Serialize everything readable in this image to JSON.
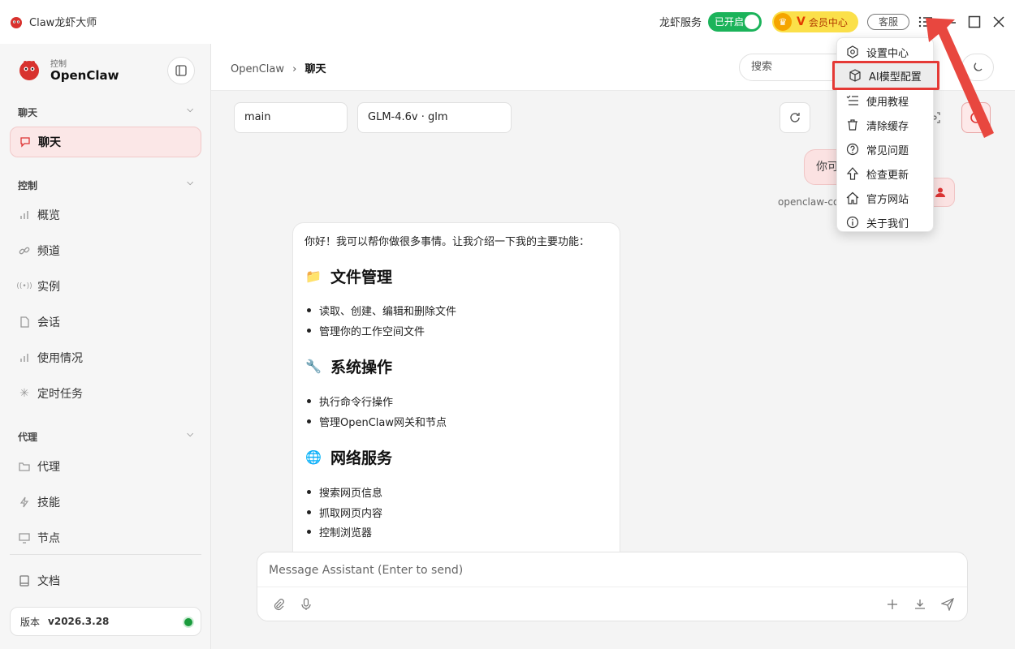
{
  "window": {
    "app_title": "Claw龙虾大师",
    "service_label": "龙虾服务",
    "service_toggle": "已开启",
    "vip_letter": "V",
    "vip_label": "会员中心",
    "support_button": "客服"
  },
  "sidebar": {
    "brand_sub": "控制",
    "brand_name": "OpenClaw",
    "sections": [
      {
        "title": "聊天",
        "items": [
          {
            "label": "聊天",
            "icon": "chat-icon",
            "active": true
          }
        ]
      },
      {
        "title": "控制",
        "items": [
          {
            "label": "概览",
            "icon": "bar-chart-icon"
          },
          {
            "label": "频道",
            "icon": "link-icon"
          },
          {
            "label": "实例",
            "icon": "broadcast-icon"
          },
          {
            "label": "会话",
            "icon": "document-icon"
          },
          {
            "label": "使用情况",
            "icon": "bar-chart-icon"
          },
          {
            "label": "定时任务",
            "icon": "loader-icon"
          }
        ]
      },
      {
        "title": "代理",
        "items": [
          {
            "label": "代理",
            "icon": "folder-icon"
          },
          {
            "label": "技能",
            "icon": "bolt-icon"
          },
          {
            "label": "节点",
            "icon": "monitor-icon"
          }
        ]
      }
    ],
    "docs_label": "文档",
    "version_label": "版本",
    "version_value": "v2026.3.28"
  },
  "header": {
    "breadcrumb_root": "OpenClaw",
    "breadcrumb_sep": "›",
    "breadcrumb_current": "聊天",
    "search_placeholder": "搜索"
  },
  "chat": {
    "session_select": "main",
    "model_select": "GLM-4.6v · glm",
    "user_message": "你可",
    "sender_name": "openclaw-con",
    "assistant": {
      "intro": "你好！我可以帮你做很多事情。让我介绍一下我的主要功能：",
      "sections": [
        {
          "emoji": "📁",
          "title": "文件管理",
          "items": [
            "读取、创建、编辑和删除文件",
            "管理你的工作空间文件"
          ]
        },
        {
          "emoji": "🔧",
          "title": "系统操作",
          "items": [
            "执行命令行操作",
            "管理OpenClaw网关和节点"
          ]
        },
        {
          "emoji": "🌐",
          "title": "网络服务",
          "items": [
            "搜索网页信息",
            "抓取网页内容",
            "控制浏览器"
          ]
        }
      ]
    },
    "composer_placeholder": "Message Assistant (Enter to send)"
  },
  "menu": {
    "items": [
      {
        "label": "设置中心",
        "icon": "settings-icon"
      },
      {
        "label": "AI模型配置",
        "icon": "cube-icon",
        "highlighted": true
      },
      {
        "label": "使用教程",
        "icon": "list-check-icon"
      },
      {
        "label": "清除缓存",
        "icon": "trash-icon"
      },
      {
        "label": "常见问题",
        "icon": "help-icon"
      },
      {
        "label": "检查更新",
        "icon": "arrow-up-icon"
      },
      {
        "label": "官方网站",
        "icon": "home-icon"
      },
      {
        "label": "关于我们",
        "icon": "info-icon"
      }
    ]
  },
  "colors": {
    "accent": "#d33333",
    "toggle_on": "#1bb35a",
    "vip_bg": "#fbe04a",
    "highlight_border": "#e53935"
  }
}
